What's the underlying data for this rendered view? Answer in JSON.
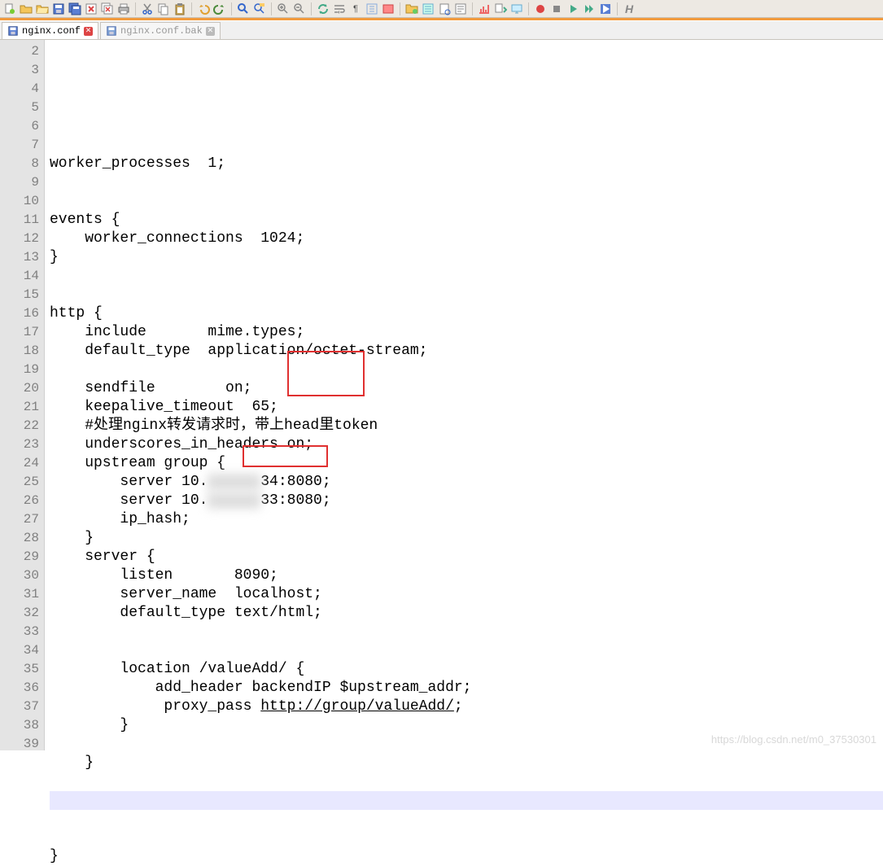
{
  "tabs": [
    {
      "name": "nginx.conf",
      "active": true
    },
    {
      "name": "nginx.conf.bak",
      "active": false
    }
  ],
  "toolbar_icons": [
    "new-file-icon",
    "open-folder-icon",
    "open-icon",
    "save-icon",
    "save-all-icon",
    "close-icon",
    "close-all-icon",
    "print-icon",
    "sep",
    "cut-icon",
    "copy-icon",
    "paste-icon",
    "sep",
    "undo-icon",
    "redo-icon",
    "sep",
    "find-icon",
    "replace-icon",
    "sep",
    "zoom-in-icon",
    "zoom-out-icon",
    "sep",
    "sync-icon",
    "wrap-icon",
    "ws-icon",
    "indent-icon",
    "outdent-icon",
    "sep",
    "folder-tree-icon",
    "function-list-icon",
    "doc-map-icon",
    "sep",
    "macro-record-icon",
    "macro-play-icon",
    "macro-stop-icon",
    "macro-run-icon",
    "sep",
    "plugin-icon",
    "about-icon"
  ],
  "lines": {
    "start": 2,
    "end": 39,
    "content": [
      "worker_processes  1;",
      "",
      "",
      "events {",
      "    worker_connections  1024;",
      "}",
      "",
      "",
      "http {",
      "    include       mime.types;",
      "    default_type  application/octet-stream;",
      "",
      "    sendfile        on;",
      "    keepalive_timeout  65;",
      "    #处理nginx转发请求时，带上head里token",
      "    underscores_in_headers on;",
      "    upstream group {",
      "        server 10.",
      "        server 10.",
      "        ip_hash;",
      "    }",
      "    server {",
      "        listen       8090;",
      "        server_name  localhost;",
      "        default_type text/html;",
      "",
      "",
      "        location /valueAdd/ {",
      "            add_header backendIP $upstream_addr;",
      "             proxy_pass ",
      "        }",
      "",
      "    }",
      "",
      "",
      "",
      "",
      "}"
    ],
    "line19_suffix": "34:8080;",
    "line20_suffix": "33:8080;",
    "line31_link": "http://group/valueAdd/",
    "line31_tail": ";"
  },
  "watermark": "https://blog.csdn.net/m0_37530301"
}
